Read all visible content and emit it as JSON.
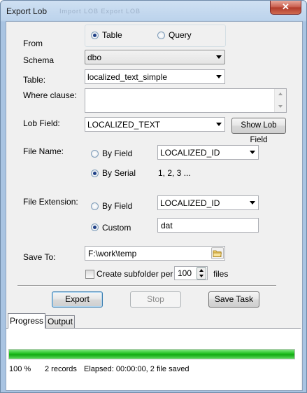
{
  "window": {
    "title": "Export Lob",
    "ghost_text": "Import LOB  Export LOB",
    "close_label": "✕"
  },
  "form": {
    "from": {
      "label": "From",
      "options": [
        "Table",
        "Query"
      ],
      "selected": "Table"
    },
    "schema": {
      "label": "Schema",
      "value": "dbo"
    },
    "table": {
      "label": "Table:",
      "value": "localized_text_simple"
    },
    "where": {
      "label": "Where clause:",
      "value": ""
    },
    "lob_field": {
      "label": "Lob Field:",
      "value": "LOCALIZED_TEXT",
      "button": "Show Lob Field"
    },
    "file_name": {
      "label": "File Name:",
      "by_field_label": "By Field",
      "by_field_value": "LOCALIZED_ID",
      "by_serial_label": "By Serial",
      "serial_text": "1, 2, 3 ...",
      "selected": "By Serial"
    },
    "file_extension": {
      "label": "File Extension:",
      "by_field_label": "By Field",
      "by_field_value": "LOCALIZED_ID",
      "custom_label": "Custom",
      "custom_value": "dat",
      "selected": "Custom"
    },
    "save_to": {
      "label": "Save To:",
      "value": "F:\\work\\temp",
      "icon": "folder-icon"
    },
    "subfolder": {
      "label": "Create subfolder per",
      "checked": false,
      "count": "100",
      "unit": "files"
    }
  },
  "buttons": {
    "export": "Export",
    "stop": "Stop",
    "save_task": "Save Task"
  },
  "tabs": [
    {
      "label": "Progress",
      "active": true
    },
    {
      "label": "Output",
      "active": false
    }
  ],
  "progress": {
    "fraction": 1.0,
    "percent_text": "100 %",
    "records_text": "2 records",
    "elapsed_text": "Elapsed: 00:00:00, 2 file saved"
  },
  "colors": {
    "progress_fill": "#20c020",
    "close_button": "#c75a4a"
  }
}
